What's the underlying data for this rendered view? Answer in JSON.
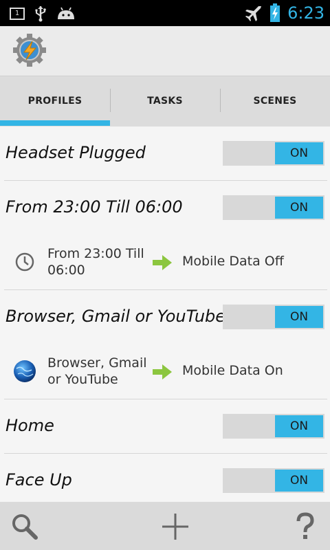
{
  "status_bar": {
    "time": "6:23",
    "icons": [
      "notification-1-icon",
      "usb-icon",
      "android-debug-icon",
      "airplane-mode-icon",
      "battery-charging-icon"
    ],
    "notification_count": "1",
    "accent_color": "#33b5e5"
  },
  "app_bar": {
    "icon": "tasker-gear-lightning-icon"
  },
  "tabs": [
    {
      "label": "PROFILES",
      "selected": true
    },
    {
      "label": "TASKS",
      "selected": false
    },
    {
      "label": "SCENES",
      "selected": false
    }
  ],
  "profiles": [
    {
      "name": "Headset Plugged",
      "toggle": "ON"
    },
    {
      "name": "From 23:00 Till 06:00",
      "toggle": "ON",
      "context": {
        "icon": "clock-icon",
        "text": "From 23:00 Till 06:00"
      },
      "task": "Mobile Data Off"
    },
    {
      "name": "Browser, Gmail or YouTube",
      "toggle": "ON",
      "context": {
        "icon": "globe-app-icon",
        "text": "Browser, Gmail or YouTube"
      },
      "task": "Mobile Data On"
    },
    {
      "name": "Home",
      "toggle": "ON"
    },
    {
      "name": "Face Up",
      "toggle": "ON"
    }
  ],
  "bottom_bar": {
    "icons": [
      "search-icon",
      "add-icon",
      "help-icon"
    ]
  }
}
